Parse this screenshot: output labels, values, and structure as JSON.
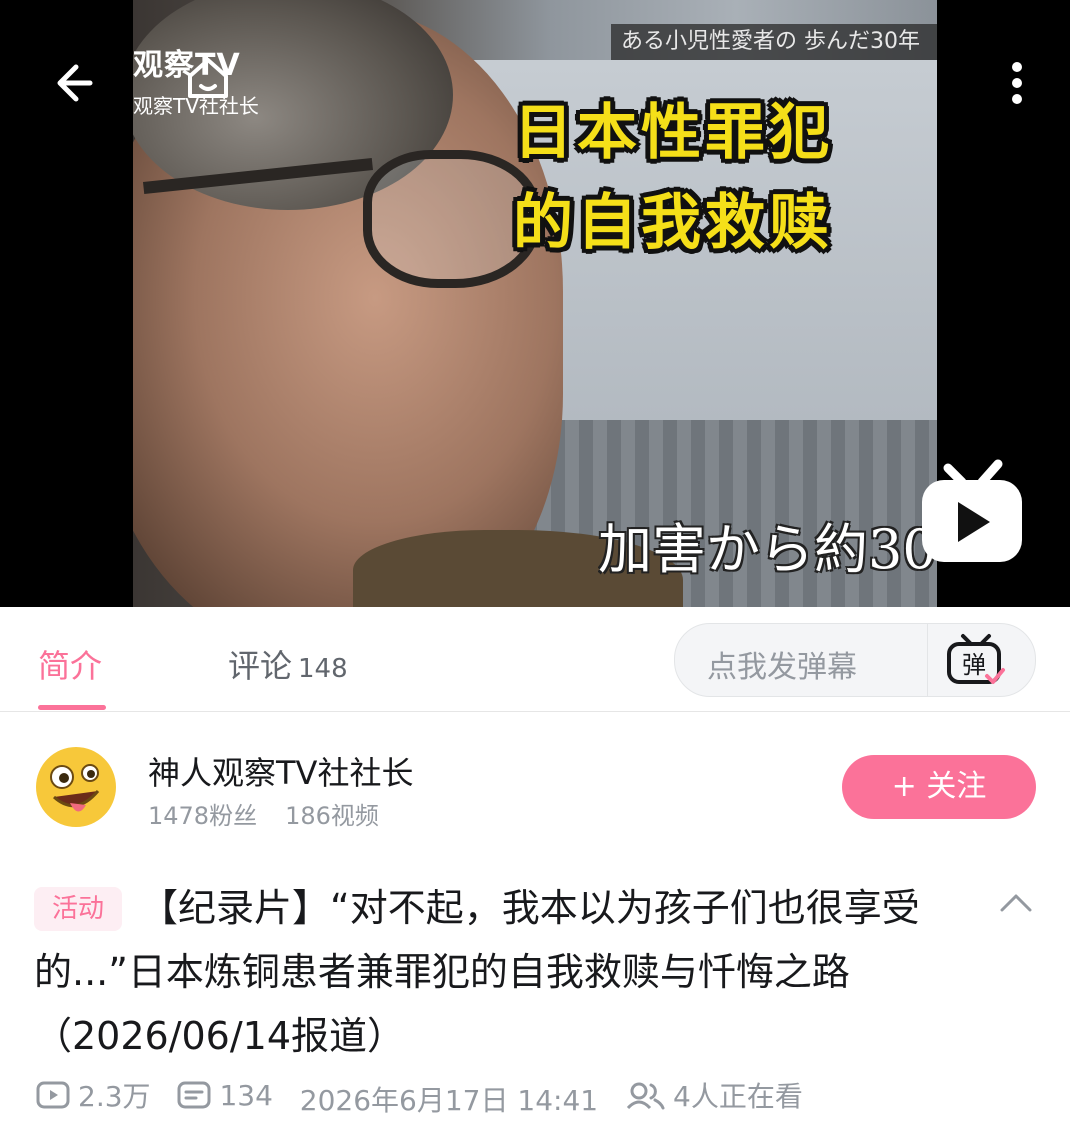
{
  "player": {
    "watermark_line1": "观察TV",
    "watermark_line2": "观察TV社社长",
    "overlay_top_jp": "ある小児性愛者の 歩んだ30年",
    "caption_line1": "日本性罪犯",
    "caption_line2": "的自我救赎",
    "overlay_bottom_jp": "加害から約30",
    "icons": [
      "back-arrow-icon",
      "home-icon",
      "more-vertical-icon",
      "tv-play-icon"
    ]
  },
  "tabs": {
    "intro_label": "简介",
    "comments_label": "评论",
    "comments_count": "148",
    "danmaku_placeholder": "点我发弹幕",
    "danmaku_icon_text": "弹"
  },
  "uploader": {
    "name": "神人观察TV社社长",
    "fans": "1478粉丝",
    "videos": "186视频",
    "follow_label": "+ 关注"
  },
  "video_info": {
    "badge": "活动",
    "title": "【纪录片】“对不起，我本以为孩子们也很享受的...”日本炼铜患者兼罪犯的自我救赎与忏悔之路（2026/06/14报道）",
    "views": "2.3万",
    "danmaku_count": "134",
    "date": "2026年6月17日 14:41",
    "watching": "4人正在看"
  },
  "colors": {
    "accent": "#fb7299",
    "caption_yellow": "#f5df19",
    "text_secondary": "#9499a0"
  }
}
